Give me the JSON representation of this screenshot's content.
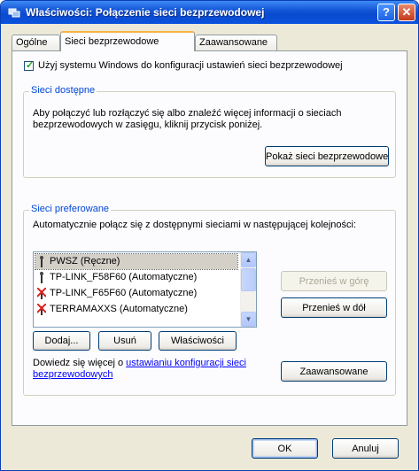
{
  "window": {
    "title": "Właściwości: Połączenie sieci bezprzewodowej",
    "help_label": "?",
    "close_label": "✕"
  },
  "tabs": [
    {
      "label": "Ogólne",
      "active": false
    },
    {
      "label": "Sieci bezprzewodowe",
      "active": true
    },
    {
      "label": "Zaawansowane",
      "active": false
    }
  ],
  "use_windows_checkbox": {
    "label": "Użyj systemu Windows do konfiguracji ustawień sieci bezprzewodowej",
    "checked": true
  },
  "available": {
    "title": "Sieci dostępne",
    "description": "Aby połączyć lub rozłączyć się albo znaleźć więcej informacji o sieciach bezprzewodowych w zasięgu, kliknij przycisk poniżej.",
    "show_button": "Pokaż sieci bezprzewodowe"
  },
  "preferred": {
    "title": "Sieci preferowane",
    "description": "Automatycznie połącz się z dostępnymi sieciami w następującej kolejności:",
    "networks": [
      {
        "name": "PWSZ",
        "mode": "(Ręczne)",
        "icon": "antenna-icon"
      },
      {
        "name": "TP-LINK_F58F60",
        "mode": "(Automatyczne)",
        "icon": "antenna-icon"
      },
      {
        "name": "TP-LINK_F65F60",
        "mode": "(Automatyczne)",
        "icon": "antenna-error-icon"
      },
      {
        "name": "TERRAMAXXS",
        "mode": "(Automatyczne)",
        "icon": "antenna-error-icon"
      }
    ],
    "move_up": "Przenieś w górę",
    "move_down": "Przenieś w dół",
    "add": "Dodaj...",
    "remove": "Usuń",
    "properties": "Właściwości",
    "info_prefix": "Dowiedz się więcej o ",
    "info_link": "ustawianiu konfiguracji sieci bezprzewodowych",
    "advanced": "Zaawansowane"
  },
  "footer": {
    "ok": "OK",
    "cancel": "Anuluj"
  },
  "colors": {
    "titlebar": "#0a4ad0",
    "group_title": "#0046d5",
    "link": "#0000ff"
  }
}
